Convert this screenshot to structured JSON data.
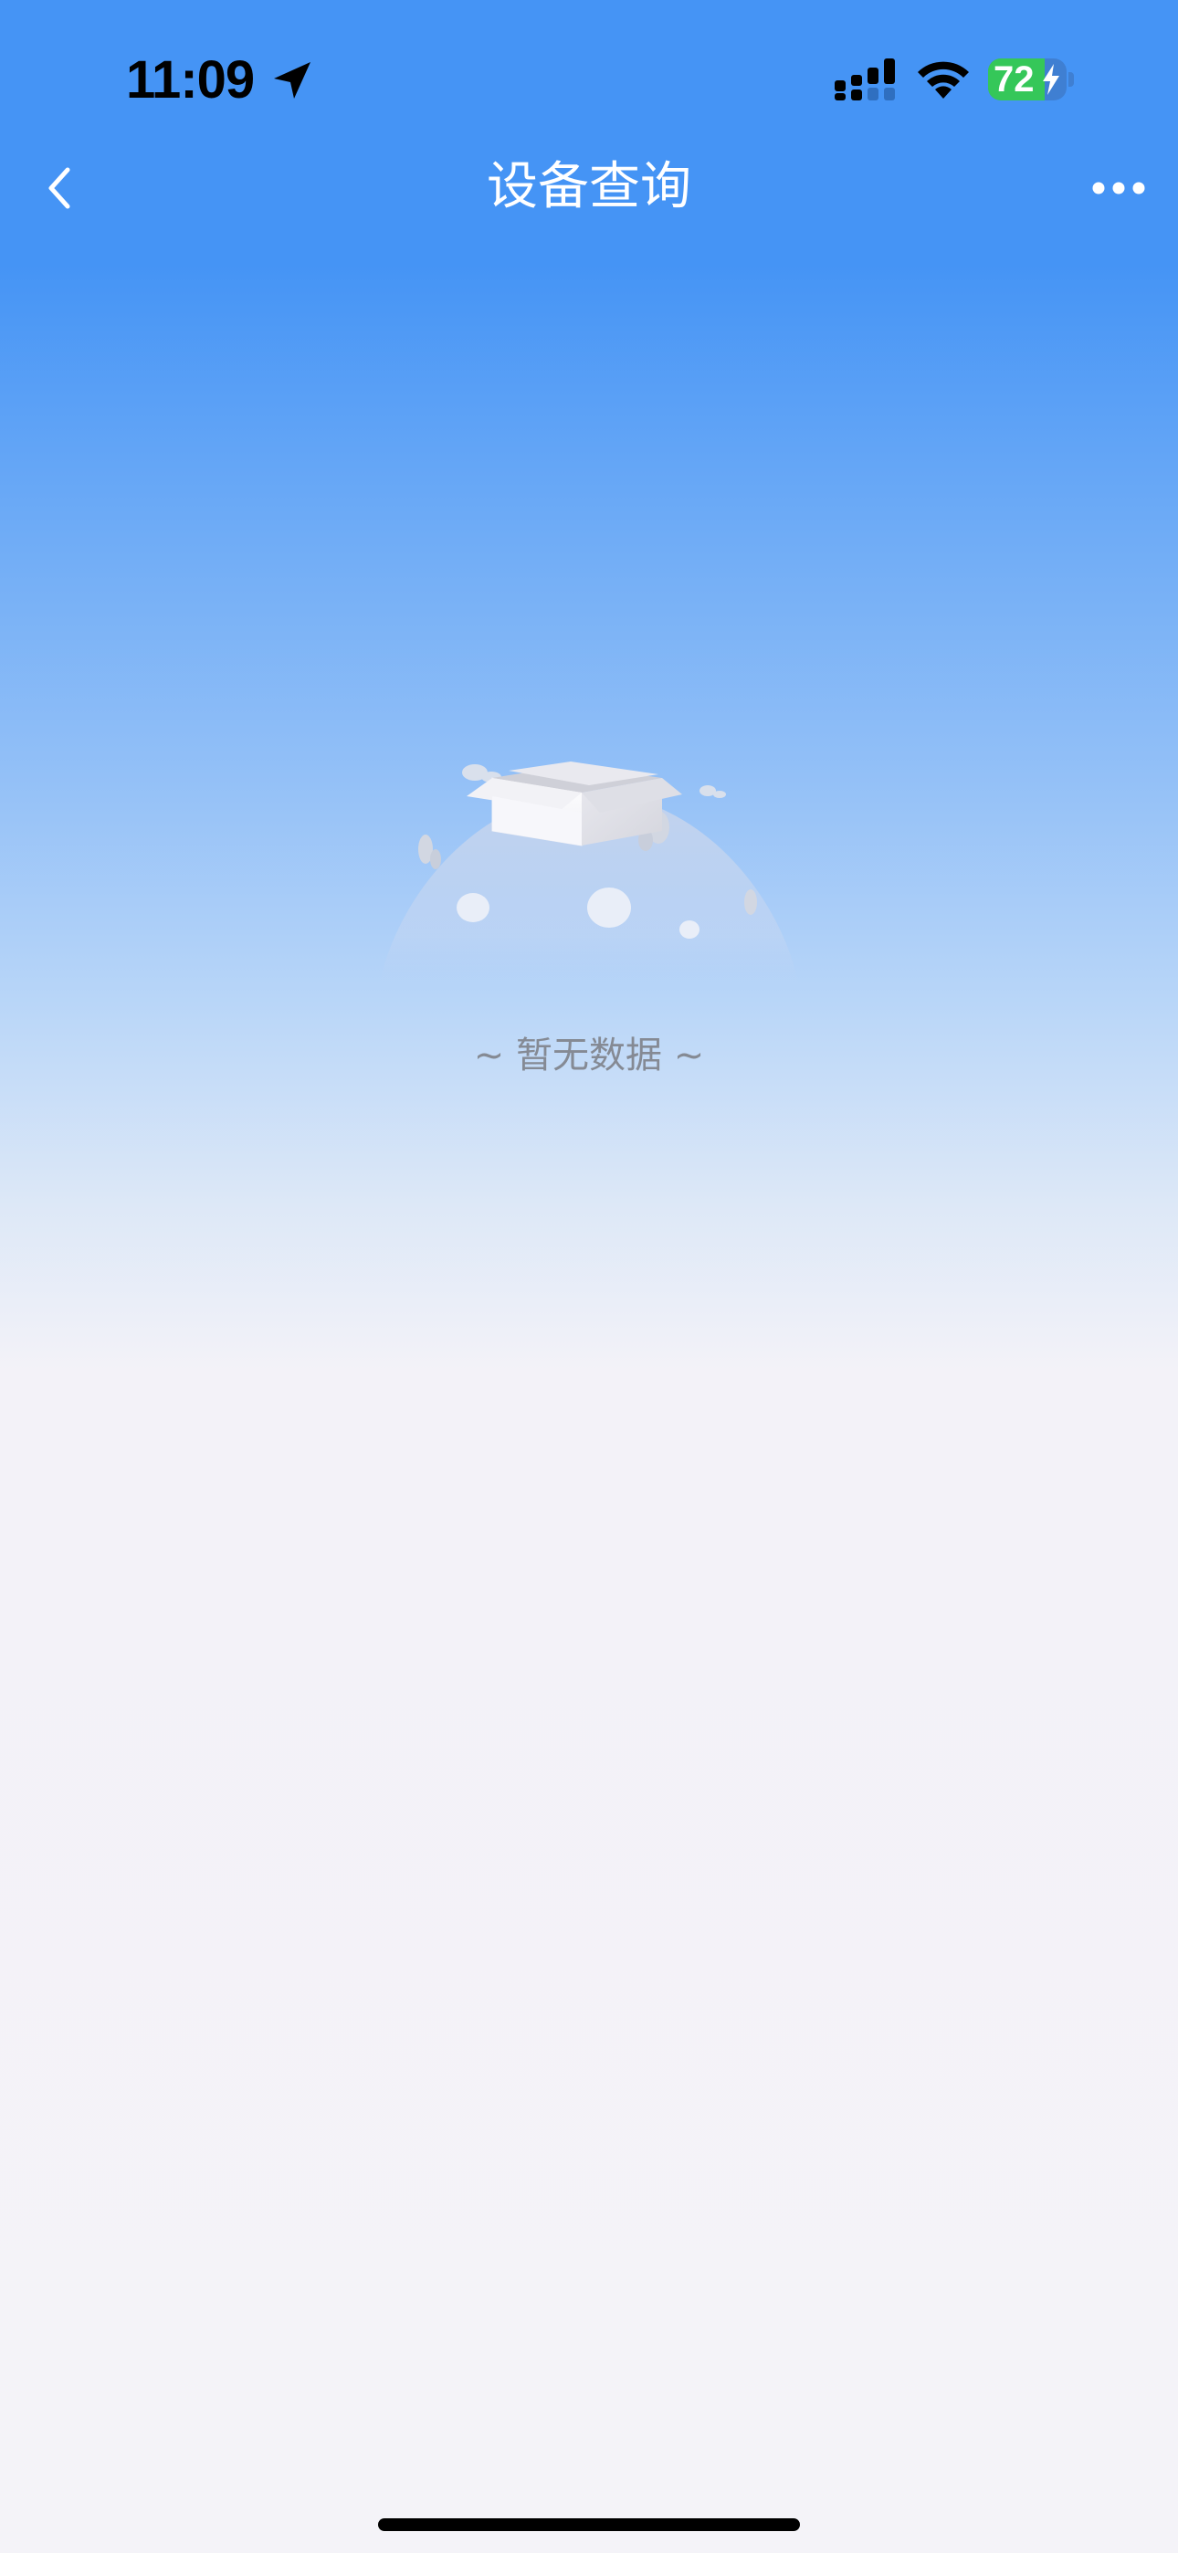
{
  "status_bar": {
    "time": "11:09",
    "battery_level": "72",
    "battery_fraction": 0.72,
    "location_icon": "location-arrow-icon",
    "signal_icon": "cellular-signal-icon",
    "wifi_icon": "wifi-icon",
    "charging_icon": "bolt-icon"
  },
  "nav": {
    "title": "设备查询",
    "back_icon": "chevron-left-icon",
    "more_icon": "ellipsis-icon"
  },
  "empty_state": {
    "text": "~ 暂无数据 ~",
    "illustration": "open-box-icon"
  },
  "colors": {
    "header_blue": "#4594f5",
    "page_background": "#f4f3f8",
    "empty_text": "#858a94",
    "battery_green": "#35c759"
  }
}
